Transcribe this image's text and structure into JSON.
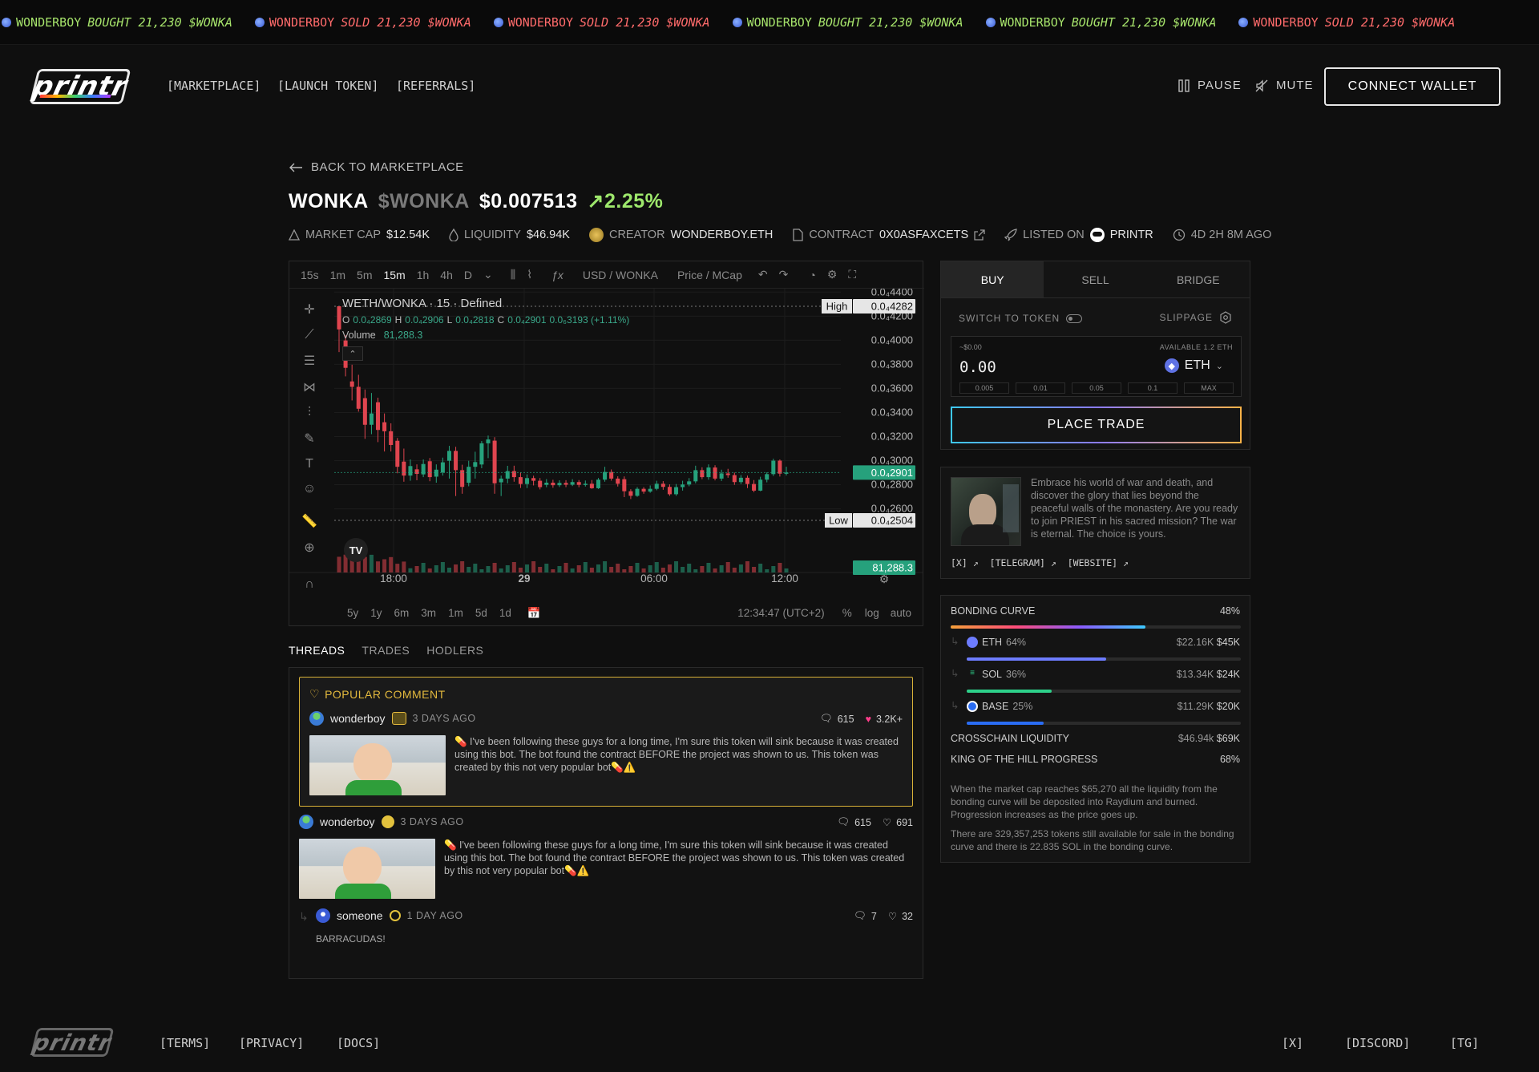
{
  "ticker": [
    {
      "user": "WONDERBOY",
      "action": "BOUGHT",
      "amount": "21,230",
      "token": "$WONKA",
      "type": "buy"
    },
    {
      "user": "WONDERBOY",
      "action": "SOLD",
      "amount": "21,230",
      "token": "$WONKA",
      "type": "sell"
    },
    {
      "user": "WONDERBOY",
      "action": "SOLD",
      "amount": "21,230",
      "token": "$WONKA",
      "type": "sell"
    },
    {
      "user": "WONDERBOY",
      "action": "BOUGHT",
      "amount": "21,230",
      "token": "$WONKA",
      "type": "buy"
    },
    {
      "user": "WONDERBOY",
      "action": "BOUGHT",
      "amount": "21,230",
      "token": "$WONKA",
      "type": "buy"
    },
    {
      "user": "WONDERBOY",
      "action": "SOLD",
      "amount": "21,230",
      "token": "$WONKA",
      "type": "sell"
    }
  ],
  "header": {
    "logo": "printr",
    "nav": [
      "[MARKETPLACE]",
      "[LAUNCH TOKEN]",
      "[REFERRALS]"
    ],
    "pause": "PAUSE",
    "mute": "MUTE",
    "connect": "CONNECT WALLET"
  },
  "back": "BACK TO MARKETPLACE",
  "token": {
    "name": "WONKA",
    "ticker": "$WONKA",
    "price": "$0.007513",
    "change": "↗2.25%",
    "change_color": "#9ee86c"
  },
  "stats": {
    "market_cap_label": "MARKET CAP",
    "market_cap": "$12.54K",
    "liquidity_label": "LIQUIDITY",
    "liquidity": "$46.94K",
    "creator_label": "CREATOR",
    "creator": "WONDERBOY.ETH",
    "contract_label": "CONTRACT",
    "contract": "0X0ASFAXCETS",
    "listed_label": "LISTED ON",
    "listed": "PRINTR",
    "age": "4D 2H 8M AGO"
  },
  "chart": {
    "intervals": [
      "15s",
      "1m",
      "5m",
      "15m",
      "1h",
      "4h",
      "D"
    ],
    "active_interval": "15m",
    "pair_toggle": "USD / WONKA",
    "price_toggle": "Price / MCap",
    "legend_title": "WETH/WONKA · 15 · Defined",
    "ohlc": {
      "o": "0.0₄2869",
      "h": "0.0₄2906",
      "l": "0.0₄2818",
      "c": "0.0₄2901",
      "chg": "0.0₆3193 (+1.11%)"
    },
    "volume_label": "Volume",
    "volume_value": "81,288.3",
    "high_label": "High",
    "high_value": "0.0₄4282",
    "low_label": "Low",
    "low_value": "0.0₄2504",
    "current_value": "0.0₄2901",
    "volume_tag": "81,288.3",
    "ranges": [
      "5y",
      "1y",
      "6m",
      "3m",
      "1m",
      "5d",
      "1d"
    ],
    "clock": "12:34:47 (UTC+2)",
    "scale_opts": [
      "%",
      "log",
      "auto"
    ]
  },
  "chart_data": {
    "type": "candlestick",
    "y_ticks": [
      "0.0₄4400",
      "0.0₄4200",
      "0.0₄4000",
      "0.0₄3800",
      "0.0₄3600",
      "0.0₄3400",
      "0.0₄3200",
      "0.0₄3000",
      "0.0₄2800",
      "0.0₄2600"
    ],
    "x_ticks": [
      "18:00",
      "29",
      "06:00",
      "12:00"
    ],
    "ylim": [
      2.504e-05,
      4.282e-05
    ],
    "candles": [
      [
        4.282e-05,
        4.09e-05,
        4.282e-05,
        3.902e-05
      ],
      [
        3.998e-05,
        3.771e-05,
        4.041e-05,
        3.7e-05
      ],
      [
        3.658e-05,
        3.613e-05,
        3.797e-05,
        3.5e-05
      ],
      [
        3.613e-05,
        3.431e-05,
        3.713e-05,
        3.407e-05
      ],
      [
        3.519e-05,
        3.298e-05,
        3.591e-05,
        3.181e-05
      ],
      [
        3.298e-05,
        3.392e-05,
        3.562e-05,
        3.22e-05
      ],
      [
        3.485e-05,
        3.255e-05,
        3.523e-05,
        3.154e-05
      ],
      [
        3.319e-05,
        3.244e-05,
        3.392e-05,
        3.076e-05
      ],
      [
        3.244e-05,
        3.13e-05,
        3.31e-05,
        3.076e-05
      ],
      [
        3.165e-05,
        2.949e-05,
        3.188e-05,
        2.895e-05
      ],
      [
        2.992e-05,
        2.876e-05,
        3.1e-05,
        2.825e-05
      ],
      [
        2.876e-05,
        2.955e-05,
        3.01e-05,
        2.833e-05
      ],
      [
        2.928e-05,
        2.89e-05,
        2.969e-05,
        2.837e-05
      ],
      [
        2.886e-05,
        2.972e-05,
        3.01e-05,
        2.863e-05
      ],
      [
        2.995e-05,
        2.863e-05,
        3.022e-05,
        2.829e-05
      ],
      [
        2.867e-05,
        2.925e-05,
        2.969e-05,
        2.817e-05
      ],
      [
        2.902e-05,
        2.986e-05,
        3.025e-05,
        2.876e-05
      ],
      [
        2.999e-05,
        3.081e-05,
        3.123e-05,
        2.851e-05
      ],
      [
        3.081e-05,
        2.921e-05,
        3.115e-05,
        2.706e-05
      ],
      [
        2.921e-05,
        2.782e-05,
        2.966e-05,
        2.725e-05
      ],
      [
        2.816e-05,
        2.949e-05,
        2.999e-05,
        2.787e-05
      ],
      [
        2.949e-05,
        2.988e-05,
        3.074e-05,
        2.851e-05
      ],
      [
        2.968e-05,
        3.144e-05,
        3.163e-05,
        2.937e-05
      ],
      [
        3.144e-05,
        3.176e-05,
        3.208e-05,
        3.021e-05
      ],
      [
        3.166e-05,
        2.812e-05,
        3.195e-05,
        2.725e-05
      ],
      [
        2.82e-05,
        2.851e-05,
        2.876e-05,
        2.706e-05
      ],
      [
        2.851e-05,
        2.913e-05,
        2.957e-05,
        2.812e-05
      ],
      [
        2.913e-05,
        2.863e-05,
        2.958e-05,
        2.825e-05
      ],
      [
        2.863e-05,
        2.806e-05,
        2.903e-05,
        2.773e-05
      ],
      [
        2.806e-05,
        2.855e-05,
        2.886e-05,
        2.772e-05
      ],
      [
        2.855e-05,
        2.833e-05,
        2.875e-05,
        2.794e-05
      ],
      [
        2.833e-05,
        2.78e-05,
        2.855e-05,
        2.761e-05
      ],
      [
        2.799e-05,
        2.817e-05,
        2.847e-05,
        2.779e-05
      ],
      [
        2.817e-05,
        2.796e-05,
        2.841e-05,
        2.775e-05
      ],
      [
        2.796e-05,
        2.815e-05,
        2.837e-05,
        2.781e-05
      ],
      [
        2.815e-05,
        2.8e-05,
        2.838e-05,
        2.78e-05
      ],
      [
        2.8e-05,
        2.822e-05,
        2.846e-05,
        2.789e-05
      ],
      [
        2.822e-05,
        2.799e-05,
        2.839e-05,
        2.779e-05
      ],
      [
        2.799e-05,
        2.808e-05,
        2.835e-05,
        2.785e-05
      ],
      [
        2.808e-05,
        2.771e-05,
        2.839e-05,
        2.766e-05
      ],
      [
        2.771e-05,
        2.842e-05,
        2.856e-05,
        2.765e-05
      ],
      [
        2.842e-05,
        2.906e-05,
        2.949e-05,
        2.825e-05
      ],
      [
        2.906e-05,
        2.851e-05,
        2.927e-05,
        2.834e-05
      ],
      [
        2.851e-05,
        2.808e-05,
        2.87e-05,
        2.785e-05
      ],
      [
        2.846e-05,
        2.746e-05,
        2.869e-05,
        2.697e-05
      ],
      [
        2.746e-05,
        2.708e-05,
        2.763e-05,
        2.681e-05
      ],
      [
        2.708e-05,
        2.766e-05,
        2.78e-05,
        2.7e-05
      ],
      [
        2.766e-05,
        2.743e-05,
        2.78e-05,
        2.725e-05
      ],
      [
        2.743e-05,
        2.766e-05,
        2.794e-05,
        2.733e-05
      ],
      [
        2.766e-05,
        2.808e-05,
        2.833e-05,
        2.754e-05
      ],
      [
        2.808e-05,
        2.782e-05,
        2.83e-05,
        2.758e-05
      ],
      [
        2.782e-05,
        2.721e-05,
        2.803e-05,
        2.708e-05
      ],
      [
        2.721e-05,
        2.78e-05,
        2.806e-05,
        2.708e-05
      ],
      [
        2.78e-05,
        2.802e-05,
        2.833e-05,
        2.751e-05
      ],
      [
        2.802e-05,
        2.828e-05,
        2.855e-05,
        2.787e-05
      ],
      [
        2.828e-05,
        2.921e-05,
        2.958e-05,
        2.812e-05
      ],
      [
        2.921e-05,
        2.863e-05,
        2.945e-05,
        2.846e-05
      ],
      [
        2.863e-05,
        2.943e-05,
        2.969e-05,
        2.842e-05
      ],
      [
        2.943e-05,
        2.851e-05,
        2.962e-05,
        2.836e-05
      ],
      [
        2.851e-05,
        2.894e-05,
        2.925e-05,
        2.831e-05
      ],
      [
        2.894e-05,
        2.88e-05,
        2.932e-05,
        2.858e-05
      ],
      [
        2.88e-05,
        2.822e-05,
        2.901e-05,
        2.799e-05
      ],
      [
        2.822e-05,
        2.858e-05,
        2.88e-05,
        2.806e-05
      ],
      [
        2.858e-05,
        2.806e-05,
        2.876e-05,
        2.772e-05
      ],
      [
        2.806e-05,
        2.751e-05,
        2.839e-05,
        2.738e-05
      ],
      [
        2.751e-05,
        2.842e-05,
        2.866e-05,
        2.746e-05
      ],
      [
        2.842e-05,
        2.888e-05,
        2.903e-05,
        2.82e-05
      ],
      [
        2.888e-05,
        3e-05,
        3.016e-05,
        2.873e-05
      ],
      [
        3e-05,
        2.892e-05,
        3.01e-05,
        2.868e-05
      ],
      [
        2.892e-05,
        2.901e-05,
        2.949e-05,
        2.877e-05
      ]
    ]
  },
  "trade": {
    "tabs": [
      "BUY",
      "SELL",
      "BRIDGE"
    ],
    "active_tab": "BUY",
    "switch_label": "SWITCH TO TOKEN",
    "slippage_label": "SLIPPAGE",
    "usd_value": "~$0.00",
    "available": "AVAILABLE 1.2 ETH",
    "amount": "0.00",
    "currency": "ETH",
    "presets": [
      "0.005",
      "0.01",
      "0.05",
      "0.1",
      "MAX"
    ],
    "place": "PLACE TRADE"
  },
  "about": {
    "description": "Embrace his world of war and death, and discover the glory that lies beyond the peaceful walls of the monastery. Are you ready to join PRIEST in his sacred mission? The war is eternal. The choice is yours.",
    "links": [
      "[X]",
      "[TELEGRAM]",
      "[WEBSITE]"
    ]
  },
  "bonding": {
    "title": "BONDING CURVE",
    "percent": "48%",
    "progress": 0.67,
    "chains": [
      {
        "name": "ETH",
        "pct": "64%",
        "amount": "$22.16K",
        "cap": "$45K",
        "fill": 0.51,
        "color": "#6d7cff"
      },
      {
        "name": "SOL",
        "pct": "36%",
        "amount": "$13.34K",
        "cap": "$24K",
        "fill": 0.31,
        "color": "#2dd08a"
      },
      {
        "name": "BASE",
        "pct": "25%",
        "amount": "$11.29K",
        "cap": "$20K",
        "fill": 0.28,
        "color": "#2a6df4"
      }
    ],
    "crosschain_label": "CROSSCHAIN LIQUIDITY",
    "crosschain_amount": "$46.94k",
    "crosschain_cap": "$69K",
    "koth_label": "KING OF THE HILL PROGRESS",
    "koth_pct": "68%",
    "note1": "When the market cap reaches $65,270 all the liquidity from the bonding curve will be deposited into Raydium and burned. Progression increases as the price goes up.",
    "note2": "There are 329,357,253 tokens still available for sale in the bonding curve and there is 22.835 SOL in the bonding curve."
  },
  "comments_tabs": [
    "THREADS",
    "TRADES",
    "HODLERS"
  ],
  "popular": {
    "label": "POPULAR COMMENT",
    "user": "wonderboy",
    "ago": "3 DAYS AGO",
    "replies": "615",
    "likes": "3.2K+",
    "text": "💊 I've been following these guys for a long time, I'm sure this token will sink because it was created using this bot. The bot found the contract BEFORE the project was shown to us. This token was created by this not very popular bot💊⚠️"
  },
  "comment2": {
    "user": "wonderboy",
    "ago": "3 DAYS AGO",
    "replies": "615",
    "likes": "691",
    "text": "💊 I've been following these guys for a long time, I'm sure this token will sink because it was created using this bot. The bot found the contract BEFORE the project was shown to us. This token was created by this not very popular bot💊⚠️"
  },
  "reply": {
    "user": "someone",
    "ago": "1 DAY AGO",
    "replies": "7",
    "likes": "32",
    "text": "BARRACUDAS!"
  },
  "footer": {
    "links_left": [
      "[TERMS]",
      "[PRIVACY]",
      "[DOCS]"
    ],
    "links_right": [
      "[X]",
      "[DISCORD]",
      "[TG]"
    ]
  }
}
